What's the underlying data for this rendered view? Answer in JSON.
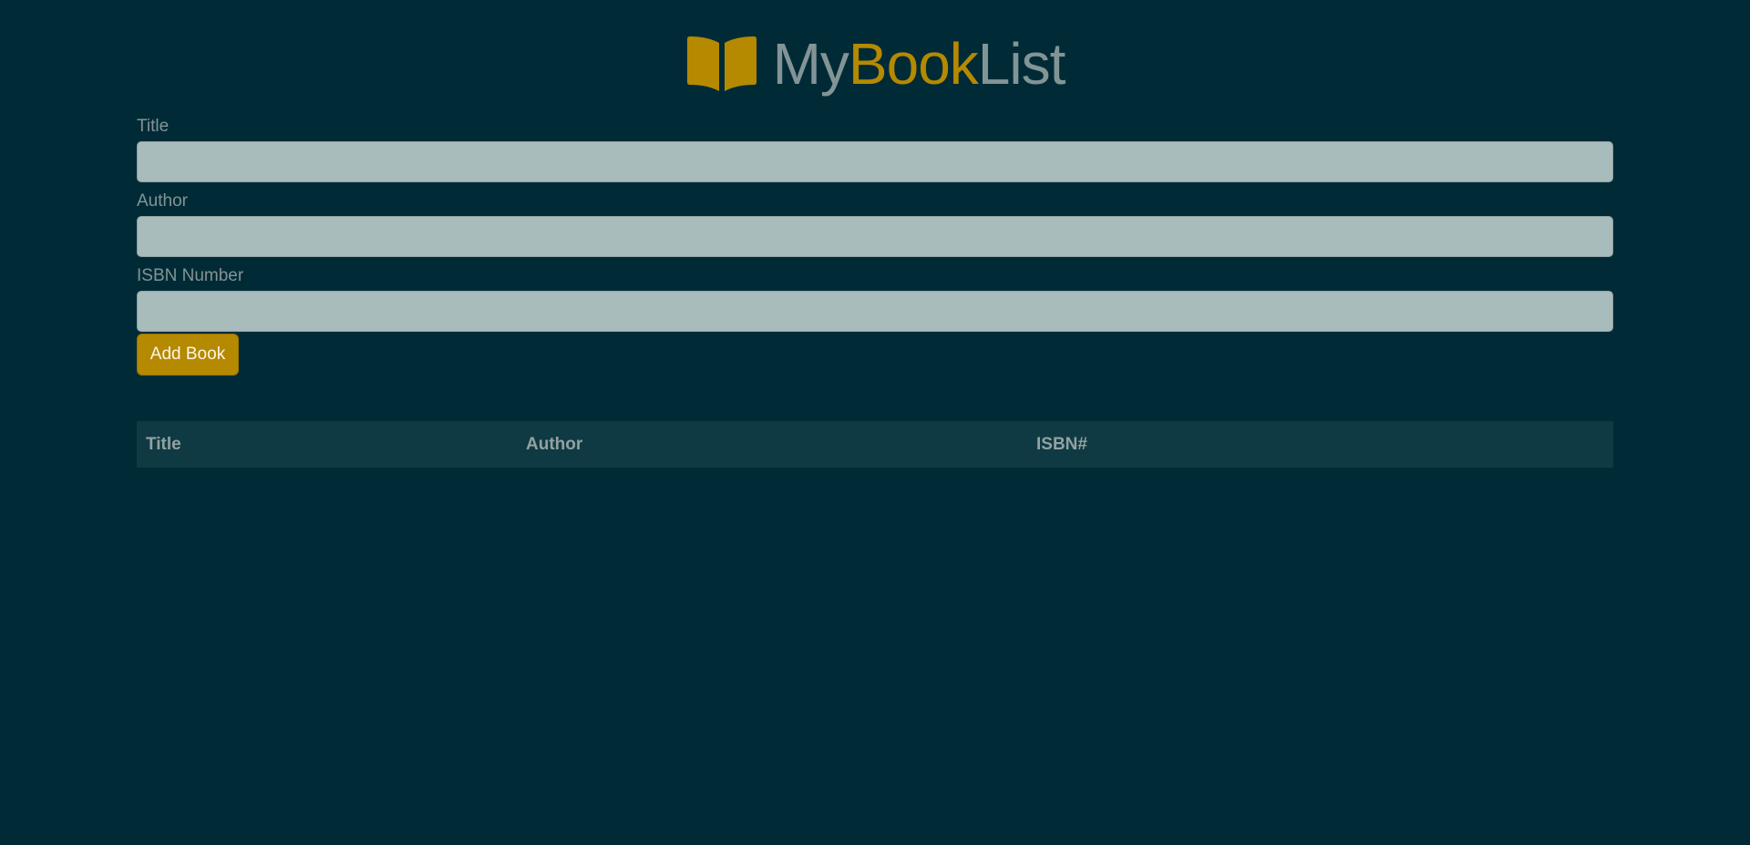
{
  "header": {
    "brand_part1": "My",
    "brand_part2": "Book",
    "brand_part3": "List",
    "icon": "book-open-icon"
  },
  "form": {
    "title_label": "Title",
    "title_value": "",
    "author_label": "Author",
    "author_value": "",
    "isbn_label": "ISBN Number",
    "isbn_value": "",
    "submit_label": "Add Book"
  },
  "table": {
    "columns": [
      "Title",
      "Author",
      "ISBN#"
    ],
    "rows": []
  },
  "colors": {
    "background": "#002b36",
    "accent": "#b58900",
    "text_muted": "#839496",
    "input_bg": "#a7bcbb",
    "table_header_bg": "#0f3a44"
  }
}
